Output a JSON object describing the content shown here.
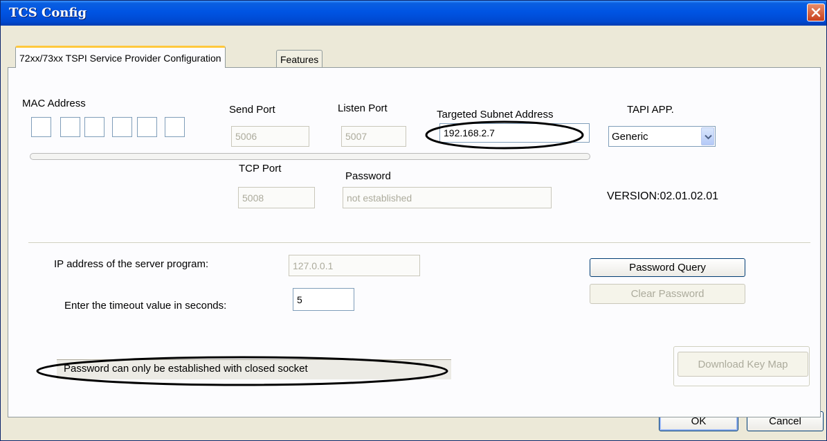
{
  "window": {
    "title": "TCS Config"
  },
  "tabs": [
    {
      "label": "72xx/73xx TSPI Service Provider Configuration",
      "active": true
    },
    {
      "label": "Features",
      "active": false
    }
  ],
  "config": {
    "mac_label": "MAC Address",
    "send_port_label": "Send Port",
    "send_port_value": "5006",
    "listen_port_label": "Listen Port",
    "listen_port_value": "5007",
    "subnet_label": "Targeted Subnet Address",
    "subnet_value": "192.168.2.7",
    "tapi_label": "TAPI APP.",
    "tapi_value": "Generic",
    "tcp_port_label": "TCP Port",
    "tcp_port_value": "5008",
    "password_label": "Password",
    "password_value": "not established",
    "version": "VERSION:02.01.02.01"
  },
  "server": {
    "ip_label": "IP address of the server program:",
    "ip_value": "127.0.0.1",
    "timeout_label": "Enter the timeout value in seconds:",
    "timeout_value": "5"
  },
  "buttons": {
    "password_query": "Password Query",
    "clear_password": "Clear Password",
    "download_key_map": "Download Key Map",
    "ok": "OK",
    "cancel": "Cancel"
  },
  "status": {
    "message": "Password can only be established with closed socket"
  },
  "colors": {
    "titlebar": "#0054e3",
    "dialog_bg": "#ece9d8",
    "annotation": "#000000"
  }
}
